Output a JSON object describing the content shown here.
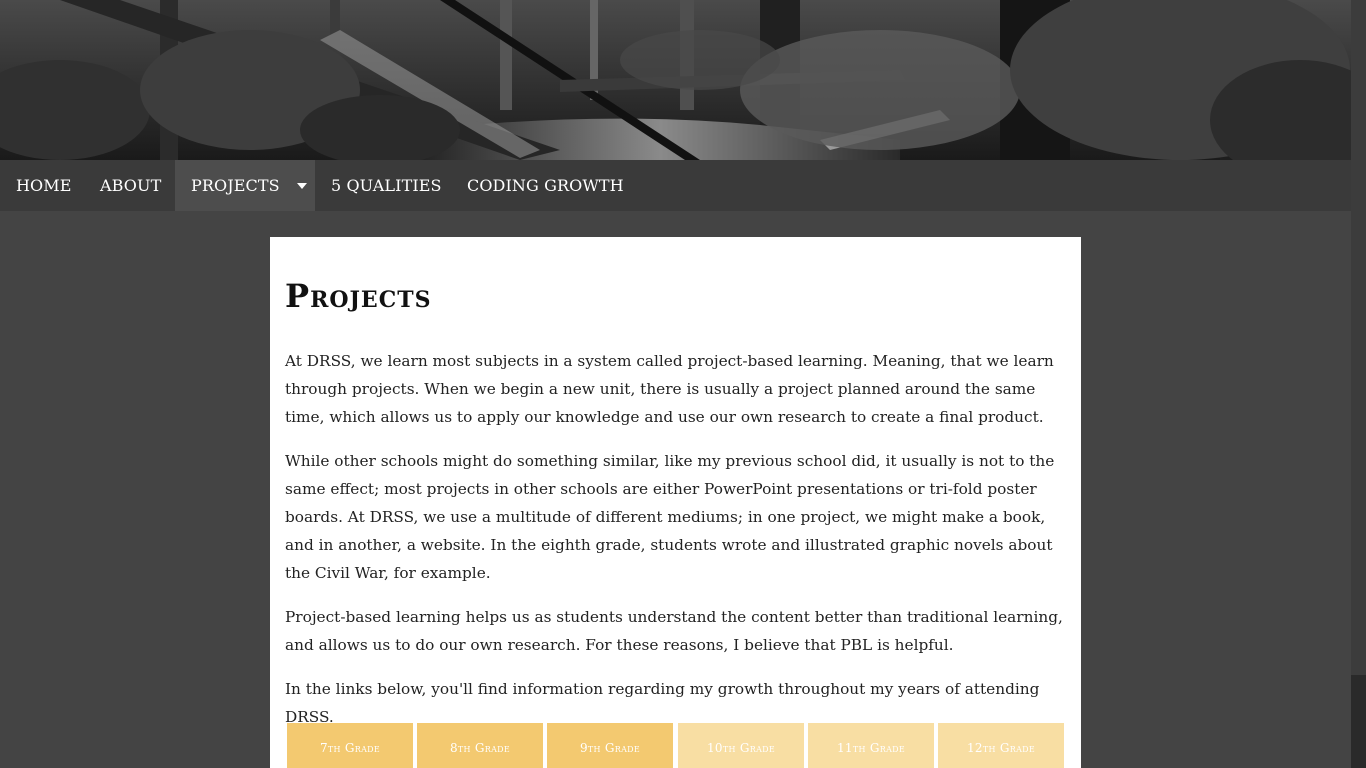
{
  "nav": {
    "items": [
      {
        "label": "HOME"
      },
      {
        "label": "ABOUT"
      },
      {
        "label": "PROJECTS"
      },
      {
        "label": "5 QUALITIES"
      },
      {
        "label": "CODING GROWTH"
      }
    ]
  },
  "main": {
    "title": "Projects",
    "paragraphs": [
      "At DRSS, we learn most subjects in a system called project-based learning. Meaning, that we learn through projects. When we begin a new unit, there is usually a project planned around the same time, which allows us to apply our knowledge and use our own research to create a final product.",
      "While other schools might do something similar, like my previous school did, it usually is not to the same effect; most projects in other schools are either PowerPoint presentations or tri-fold poster boards. At DRSS, we use a multitude of different mediums; in one project, we might make a book, and in another, a website. In the eighth grade, students wrote and illustrated graphic novels about the Civil War, for example.",
      "Project-based learning helps us as students understand the content better than traditional learning, and allows us to do our own research. For these reasons, I believe that PBL is helpful.",
      "In the links below, you'll find information regarding my growth throughout my years of attending DRSS."
    ],
    "grades": [
      {
        "label": "7th Grade"
      },
      {
        "label": "8th Grade"
      },
      {
        "label": "9th Grade"
      },
      {
        "label": "10th Grade"
      },
      {
        "label": "11th Grade"
      },
      {
        "label": "12th Grade"
      }
    ]
  },
  "colors": {
    "grade_strong": "#f3c970",
    "grade_light": "#f8dea3",
    "nav_bg": "#3a3a3a",
    "page_bg": "#444444"
  }
}
